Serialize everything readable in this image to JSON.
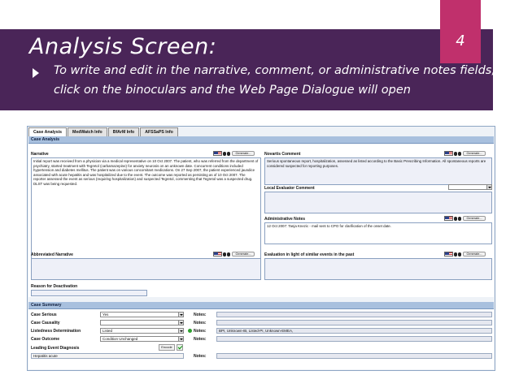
{
  "slide": {
    "title": "Analysis Screen:",
    "number": "4",
    "bullet_line1": "To write and edit in the narrative, comment, or administrative notes fields,",
    "bullet_line2": "click on the binoculars and the Web Page Dialogue will open"
  },
  "app": {
    "tabs": [
      "Case Analysis",
      "MedWatch Info",
      "BfArM Info",
      "AFSSaPS Info"
    ],
    "case_analysis": {
      "section_title": "Case Analysis",
      "generate_label": "Generate...",
      "narrative": {
        "label": "Narrative",
        "text": "Initial report was received from a physician via a medical representative on 10 Oct 2007. The patient, who was referred from the department of psychiatry, started treatment with Tegretol (carbamazepine) for anxiety neurosis on an unknown date. Concurrent conditions included hypertension and diabetes mellitus. The patient was on various concomitant medications. On 27 Sep 2007, the patient experienced jaundice associated with acute hepatitis and was hospitalized due to the event. The outcome was reported as persisting as of 10 Oct 2007. The reporter assessed the event as serious (requiring hospitalization) and suspected Tegretol, commenting that Tegretol was a suspected drug. DLST was being requested."
      },
      "novartis_comment": {
        "label": "Novartis Comment",
        "text": "Serious spontaneous report, hospitalization, assessed as listed according to the Basic Prescribing Information. All spontaneous reports are considered suspected for reporting purposes."
      },
      "local_evaluator_comment": {
        "label": "Local Evaluator Comment"
      },
      "administrative_notes": {
        "label": "Administrative Notes",
        "text": "12 Oct 2007: Tanja Knezic - mail sent to CPO for clarification of the onset date."
      },
      "abbreviated_narrative": {
        "label": "Abbreviated Narrative"
      },
      "evaluation": {
        "label": "Evaluation in light of similar events in the past"
      },
      "reason_for_deactivation": {
        "label": "Reason for Deactivation"
      }
    },
    "case_summary": {
      "section_title": "Case Summary",
      "notes_label": "Notes:",
      "rows": [
        {
          "label": "Case Serious",
          "value": "Yes",
          "notes": ""
        },
        {
          "label": "Case Causality",
          "value": "",
          "notes": ""
        },
        {
          "label": "Listedness Determination",
          "value": "Listed",
          "notes": "BPI,  Unknown-IB,  Listed-PI,  Unknown-EMEA,"
        },
        {
          "label": "Case Outcome",
          "value": "Condition Unchanged",
          "notes": ""
        }
      ],
      "leading_event_diagnosis": {
        "label": "Leading Event Diagnosis",
        "encode_label": "Encode",
        "value": "Hepatitis acute",
        "notes": ""
      }
    }
  },
  "colors": {
    "header_band": "#4a2558",
    "number_box": "#c0306c",
    "section_bar": "#a8c0de"
  }
}
